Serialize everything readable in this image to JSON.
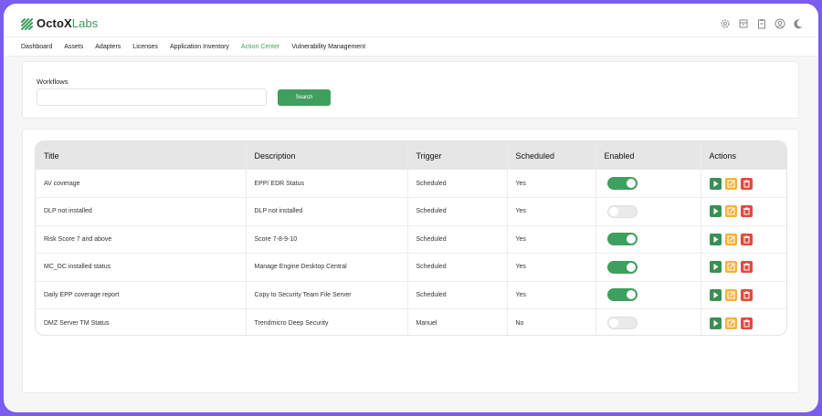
{
  "app": {
    "brand_bold": "OctoX",
    "brand_light": "Labs"
  },
  "top_icons": [
    "gear-icon",
    "archive-icon",
    "clipboard-icon",
    "user-icon",
    "moon-icon"
  ],
  "nav": {
    "items": [
      {
        "label": "Dashboard",
        "active": false
      },
      {
        "label": "Assets",
        "active": false
      },
      {
        "label": "Adapters",
        "active": false
      },
      {
        "label": "Licenses",
        "active": false
      },
      {
        "label": "Application Inventory",
        "active": false
      },
      {
        "label": "Action Center",
        "active": true
      },
      {
        "label": "Vulnerability Management",
        "active": false
      }
    ]
  },
  "workflows": {
    "label": "Workflows",
    "input_value": "",
    "search_label": "Search"
  },
  "table": {
    "headers": [
      "Title",
      "Description",
      "Trigger",
      "Scheduled",
      "Enabled",
      "Actions"
    ],
    "rows": [
      {
        "title": "AV coverage",
        "description": "EPP/ EDR Status",
        "trigger": "Scheduled",
        "scheduled": "Yes",
        "enabled": true
      },
      {
        "title": "DLP not installed",
        "description": "DLP not installed",
        "trigger": "Scheduled",
        "scheduled": "Yes",
        "enabled": false
      },
      {
        "title": "Risk Score 7 and above",
        "description": "Score 7-8-9-10",
        "trigger": "Scheduled",
        "scheduled": "Yes",
        "enabled": true
      },
      {
        "title": "MC_DC installed status",
        "description": "Manage Engine Desktop Central",
        "trigger": "Scheduled",
        "scheduled": "Yes",
        "enabled": true
      },
      {
        "title": "Daily EPP coverage report",
        "description": "Copy to Security Team File Server",
        "trigger": "Scheduled",
        "scheduled": "Yes",
        "enabled": true
      },
      {
        "title": "DMZ Server TM Status",
        "description": "Trendmicro Deep Security",
        "trigger": "Manuel",
        "scheduled": "No",
        "enabled": false
      }
    ],
    "action_icons": [
      "play-icon",
      "edit-icon",
      "delete-icon"
    ]
  },
  "colors": {
    "background": "#7b5cf0",
    "accent_green": "#3f9f5e",
    "edit_yellow": "#f2b33a",
    "delete_red": "#e14a3e"
  }
}
